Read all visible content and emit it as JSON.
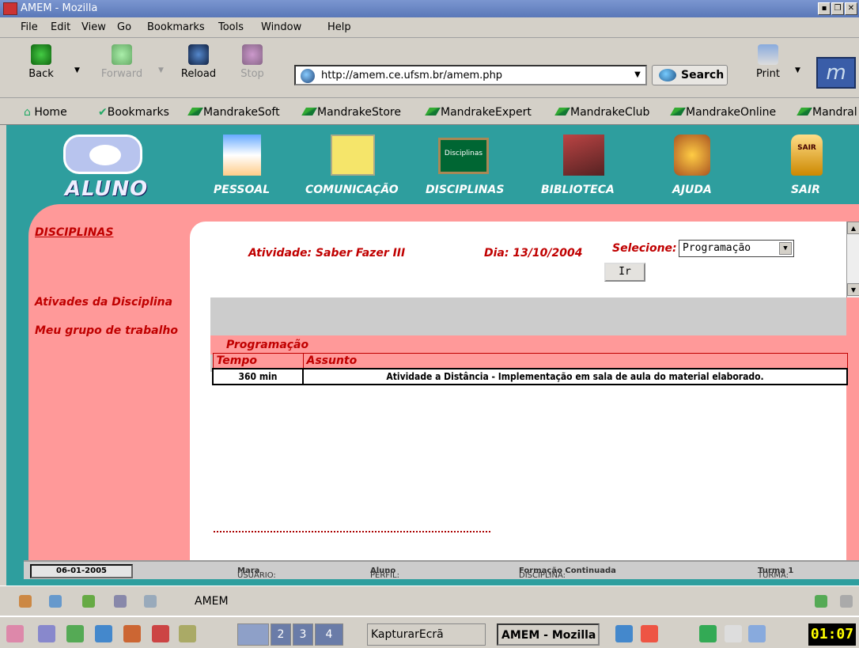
{
  "window": {
    "title": "AMEM - Mozilla"
  },
  "menu": [
    "File",
    "Edit",
    "View",
    "Go",
    "Bookmarks",
    "Tools",
    "Window",
    "Help"
  ],
  "nav": {
    "back": "Back",
    "forward": "Forward",
    "reload": "Reload",
    "stop": "Stop",
    "url": "http://amem.ce.ufsm.br/amem.php",
    "search": "Search",
    "print": "Print"
  },
  "bookmarks": [
    "Home",
    "Bookmarks",
    "MandrakeSoft",
    "MandrakeStore",
    "MandrakeExpert",
    "MandrakeClub",
    "MandrakeOnline",
    "Mandral"
  ],
  "site": {
    "brand": "ALUNO",
    "topnav": [
      "PESSOAL",
      "COMUNICAÇÃO",
      "DISCIPLINAS",
      "BIBLIOTECA",
      "AJUDA",
      "SAIR"
    ],
    "disciplinas_board": "Disciplinas",
    "sair_badge": "SAIR",
    "sidebar": {
      "title": "DISCIPLINAS",
      "links": [
        "Ativades da Disciplina",
        "Meu grupo de trabalho"
      ]
    },
    "activity": "Atividade: Saber Fazer III",
    "day": "Dia: 13/10/2004",
    "select_label": "Selecione:",
    "select_value": "Programação",
    "go_button": "Ir",
    "section_title": "Programação",
    "table": {
      "headers": [
        "Tempo",
        "Assunto"
      ],
      "rows": [
        [
          "360 min",
          "Atividade a Distância - Implementação em sala de aula do material elaborado."
        ]
      ]
    },
    "footer": {
      "date": "06-01-2005",
      "usuario_label": "USUÁRIO:",
      "usuario": "Mara",
      "perfil_label": "PERFIL:",
      "perfil": "Aluno",
      "disciplina_label": "DISCIPLINA:",
      "disciplina": "Formação Continuada",
      "turma_label": "TURMA:",
      "turma": "Turma 1"
    }
  },
  "status": {
    "text": "AMEM"
  },
  "taskbar": {
    "desktops": [
      "2",
      "3",
      "4"
    ],
    "tasks": [
      "KapturarEcrã",
      "AMEM - Mozilla"
    ],
    "clock": "01:07"
  }
}
